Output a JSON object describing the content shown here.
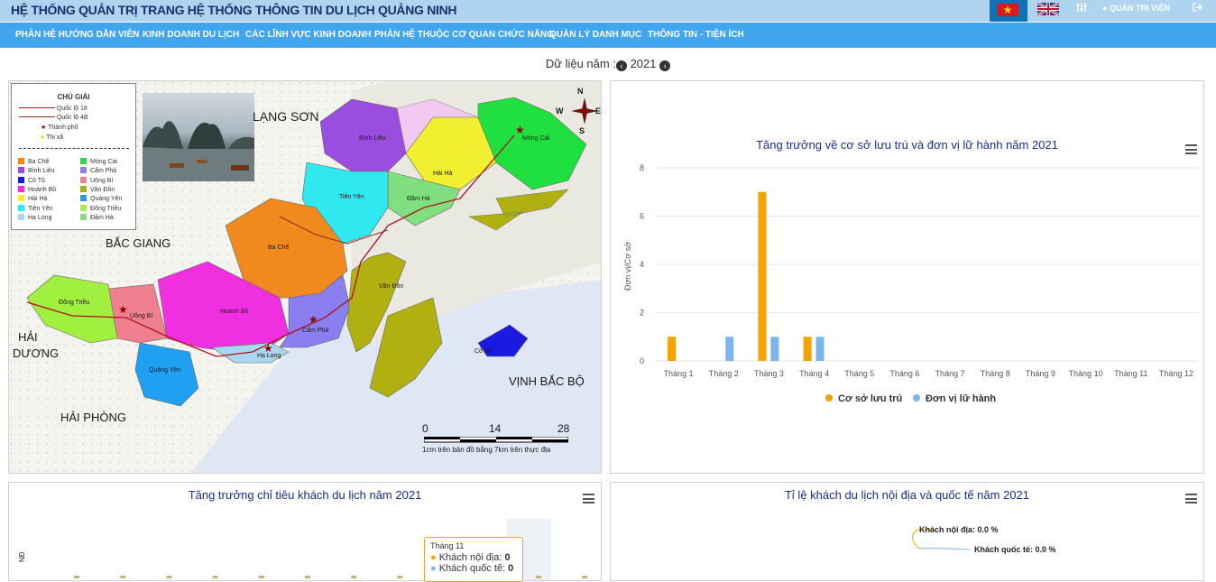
{
  "header": {
    "title": "HỆ THỐNG QUẢN TRỊ TRANG HỆ THỐNG THÔNG TIN DU LỊCH QUẢNG NINH",
    "admin_label": "QUẢN TRỊ VIÊN",
    "vn_flag_icon": "vn-flag-icon",
    "uk_flag_icon": "uk-flag-icon"
  },
  "nav": {
    "items": [
      "PHÂN HỆ HƯỚNG DẪN VIÊN",
      "KINH DOANH DU LỊCH",
      "CÁC LĨNH VỰC KINH DOANH",
      "PHÂN HỆ THUỘC CƠ QUAN CHỨC NĂNG",
      "QUẢN LÝ DANH MỤC",
      "THÔNG TIN - TIỆN ÍCH"
    ]
  },
  "year_selector": {
    "label": "Dữ liệu năm :",
    "year": "2021"
  },
  "map": {
    "legend_title": "CHÚ GIẢI",
    "road_labels": [
      "Quốc lộ 18",
      "Quốc lộ 4B"
    ],
    "city_label": "Thành phố",
    "town_label": "Thị xã",
    "districts_left": [
      "Ba Chẽ",
      "Bình Liêu",
      "Cô Tô",
      "Hoành Bồ",
      "Hải Hà",
      "Tiên Yên",
      "Hạ Long"
    ],
    "districts_right": [
      "Móng Cái",
      "Cẩm Phả",
      "Uông Bí",
      "Vân Đồn",
      "Quảng Yên",
      "Đông Triều",
      "Đầm Hà"
    ],
    "district_colors_left": [
      "#f08a1e",
      "#9b4de0",
      "#1a1ae0",
      "#f030e0",
      "#f2ee30",
      "#30e8f0",
      "#a8d8f0"
    ],
    "district_colors_right": [
      "#20e040",
      "#8a7ef0",
      "#f08090",
      "#b0b010",
      "#20a0f0",
      "#a0f040",
      "#80e080"
    ],
    "region_labels": {
      "lang_son": "LẠNG SƠN",
      "bac_giang": "BẮC GIANG",
      "hai_duong_1": "HẢI",
      "hai_duong_2": "DƯƠNG",
      "hai_phong": "HẢI PHÒNG",
      "vinh_bac_bo": "VỊNH BẮC BỘ"
    },
    "district_map_labels": {
      "binh_lieu": "Bình Liêu",
      "mong_cai": "Móng Cái",
      "hai_ha": "Hải Hà",
      "tien_yen": "Tiên Yên",
      "dam_ha": "Đầm Hà",
      "ba_che": "Ba Chẽ",
      "van_don": "Vân Đồn",
      "dong_trieu": "Đông Triều",
      "uong_bi": "Uông Bí",
      "hoanh_bo": "Hoành Bồ",
      "cam_pha": "Cẩm Phả",
      "ha_long": "Hạ Long",
      "quang_yen": "Quảng Yên",
      "co_to": "Cô Tô"
    },
    "compass": {
      "n": "N",
      "s": "S",
      "w": "W",
      "e": "E"
    },
    "scale_ticks": [
      "0",
      "14",
      "28"
    ],
    "scale_note": "1cm trên bản đồ bằng 7km trên thực địa"
  },
  "chart_top": {
    "title": "Tăng trưởng về cơ sở lưu trú và đơn vị lữ hành năm 2021",
    "menu_icon": "hamburger-menu-icon"
  },
  "chart_data": [
    {
      "type": "bar",
      "title": "Tăng trưởng về cơ sở lưu trú và đơn vị lữ hành năm 2021",
      "ylabel": "Đơn vị/Cơ sở",
      "ylim": [
        0,
        8
      ],
      "yticks": [
        "0",
        "2",
        "4",
        "6",
        "8"
      ],
      "categories": [
        "Tháng 1",
        "Tháng 2",
        "Tháng 3",
        "Tháng 4",
        "Tháng 5",
        "Tháng 6",
        "Tháng 7",
        "Tháng 8",
        "Tháng 9",
        "Tháng 10",
        "Tháng 11",
        "Tháng 12"
      ],
      "series": [
        {
          "name": "Cơ sở lưu trú",
          "color": "#f5a300",
          "values": [
            1,
            0,
            7,
            1,
            0,
            0,
            0,
            0,
            0,
            0,
            0,
            0
          ]
        },
        {
          "name": "Đơn vị lữ hành",
          "color": "#7cb5ec",
          "values": [
            0,
            1,
            1,
            1,
            0,
            0,
            0,
            0,
            0,
            0,
            0,
            0
          ]
        }
      ],
      "grid": true,
      "legend": "bottom"
    }
  ],
  "chart_bl": {
    "title": "Tăng trưởng chỉ tiêu khách du lịch năm 2021",
    "ylabel_partial": "NĐ",
    "tooltip_header": "Tháng 11",
    "tooltip_row1_label": "Khách nội địa:",
    "tooltip_row1_value": "0",
    "tooltip_row2_label": "Khách quốc tế:",
    "tooltip_row2_value": "0"
  },
  "chart_br": {
    "title": "Tỉ lệ khách du lịch nội địa và quốc tế năm 2021",
    "label1": "Khách nội địa: 0.0 %",
    "label2": "Khách quốc tế: 0.0 %"
  }
}
